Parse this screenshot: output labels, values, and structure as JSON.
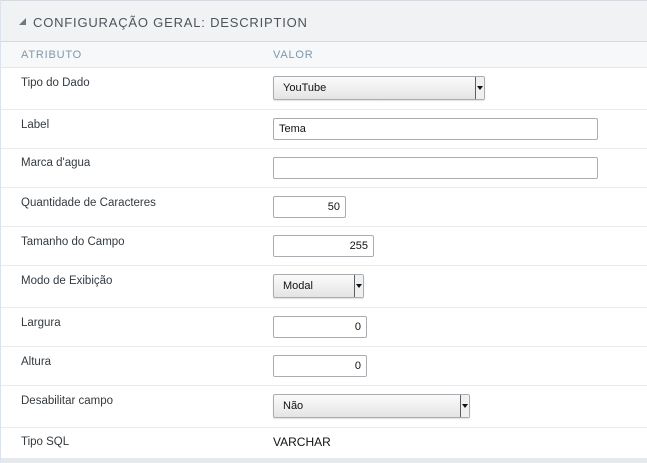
{
  "panel": {
    "title": "CONFIGURAÇÃO GERAL: DESCRIPTION",
    "columns": {
      "attribute": "ATRIBUTO",
      "value": "VALOR"
    }
  },
  "fields": {
    "tipo_dado": {
      "label": "Tipo do Dado",
      "value": "YouTube"
    },
    "label": {
      "label": "Label",
      "value": "Tema"
    },
    "marca_agua": {
      "label": "Marca d'agua",
      "value": ""
    },
    "quantidade": {
      "label": "Quantidade de Caracteres",
      "value": "50"
    },
    "tamanho": {
      "label": "Tamanho do Campo",
      "value": "255"
    },
    "modo": {
      "label": "Modo de Exibição",
      "value": "Modal"
    },
    "largura": {
      "label": "Largura",
      "value": "0"
    },
    "altura": {
      "label": "Altura",
      "value": "0"
    },
    "desabilitar": {
      "label": "Desabilitar campo",
      "value": "Não"
    },
    "tipo_sql": {
      "label": "Tipo SQL",
      "value": "VARCHAR"
    }
  },
  "icons": {
    "collapse": "collapse-triangle-icon",
    "dropdown": "dropdown-arrow-icon"
  }
}
